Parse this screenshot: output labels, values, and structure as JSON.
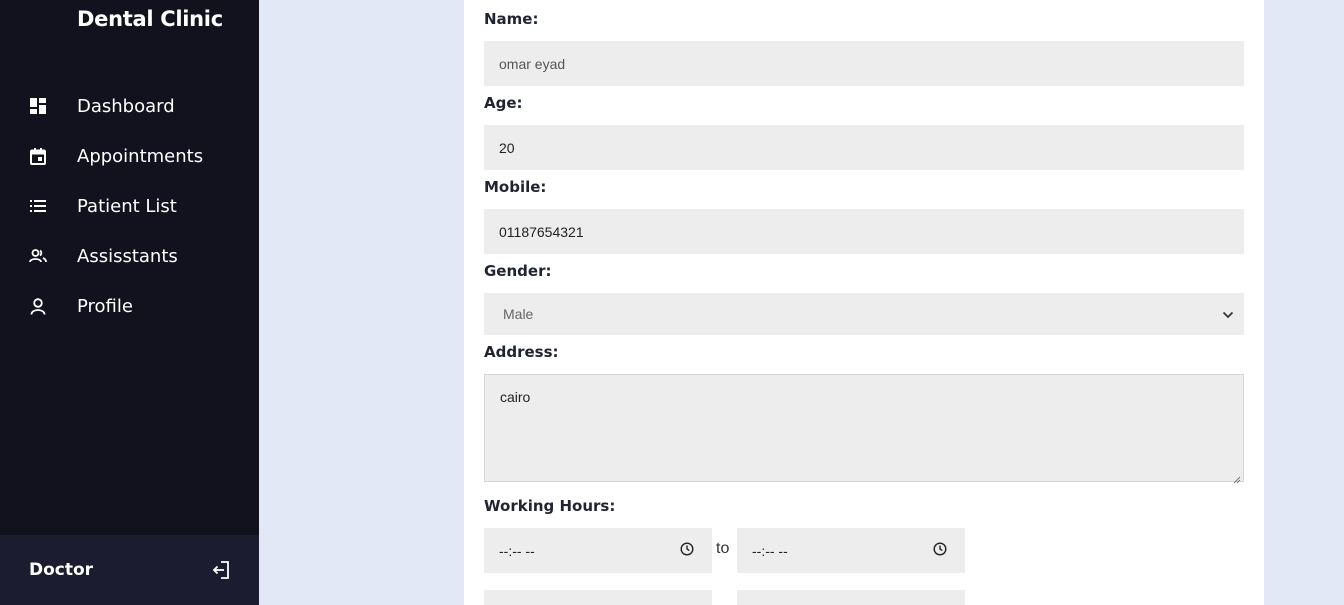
{
  "sidebar": {
    "brand": "Dental Clinic",
    "items": [
      {
        "label": "Dashboard",
        "icon": "dashboard-icon"
      },
      {
        "label": "Appointments",
        "icon": "calendar-icon"
      },
      {
        "label": "Patient List",
        "icon": "list-icon"
      },
      {
        "label": "Assisstants",
        "icon": "group-icon"
      },
      {
        "label": "Profile",
        "icon": "user-icon"
      }
    ],
    "user_role": "Doctor",
    "logout_icon": "logout-icon"
  },
  "form": {
    "name": {
      "label": "Name:",
      "value": "omar eyad"
    },
    "age": {
      "label": "Age:",
      "value": "20"
    },
    "mobile": {
      "label": "Mobile:",
      "value": "01187654321"
    },
    "gender": {
      "label": "Gender:",
      "selected": "Male"
    },
    "address": {
      "label": "Address:",
      "value": "cairo"
    },
    "working_hours": {
      "label": "Working Hours:",
      "rows": [
        {
          "from": "--:-- --",
          "separator": "to",
          "to": "--:-- --"
        }
      ]
    }
  },
  "colors": {
    "sidebar_bg": "#12121f",
    "user_bar_bg": "#1c1c30",
    "page_bg": "#e2e8f5",
    "input_bg": "#ededed"
  }
}
